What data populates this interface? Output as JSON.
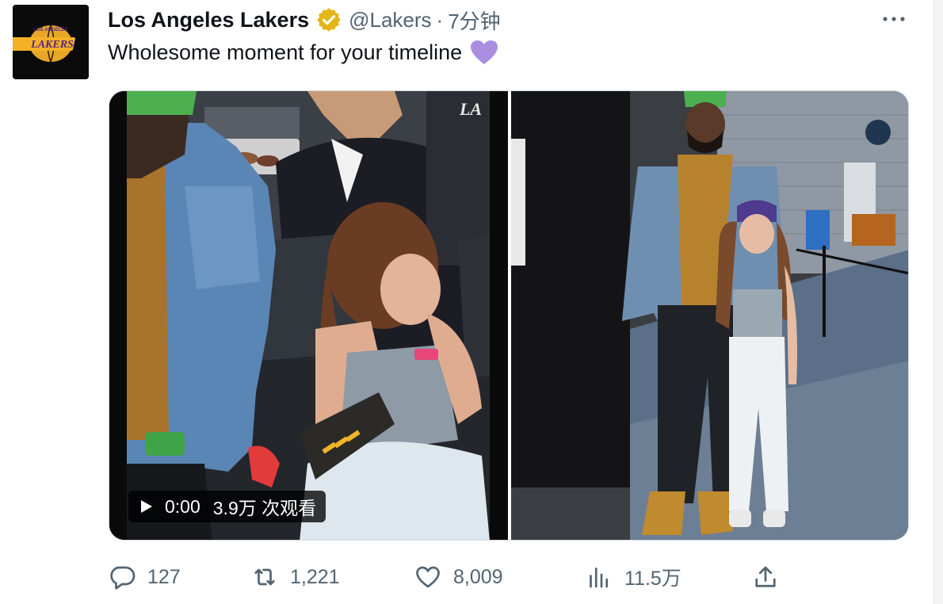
{
  "tweet": {
    "display_name": "Los Angeles Lakers",
    "handle": "@Lakers",
    "separator": "·",
    "timestamp": "7分钟",
    "text": "Wholesome moment for your timeline",
    "emoji": "purple-heart",
    "avatar": {
      "logo_text": "LAKERS",
      "logo_subtext": "LOS ANGELES",
      "colors": {
        "purple": "#552583",
        "gold": "#FDB927",
        "background": "#0b0b0b"
      }
    },
    "verified_badge_color": "#e2b719"
  },
  "media": {
    "video": {
      "duration": "0:00",
      "views": "3.9万 次观看",
      "corner_logo": "LA"
    }
  },
  "actions": {
    "replies": "127",
    "retweets": "1,221",
    "likes": "8,009",
    "views": "11.5万"
  },
  "colors": {
    "text_primary": "#0f1419",
    "text_secondary": "#536471",
    "emoji_purple": "#a98ee0"
  }
}
